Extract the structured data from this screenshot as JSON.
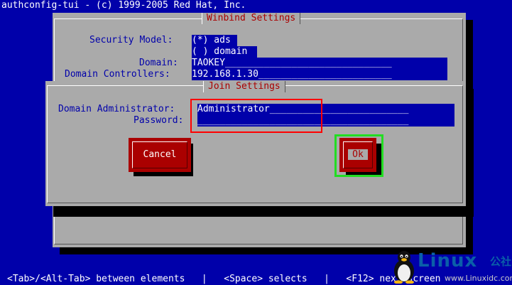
{
  "header": {
    "title": "authconfig-tui - (c) 1999-2005 Red Hat, Inc."
  },
  "winbind": {
    "title": "Winbind Settings",
    "security_model_label": "Security Model:",
    "options": [
      "(*) ads",
      "( ) domain"
    ],
    "domain_label": "Domain:",
    "domain_value": "TAOKEY______________________________",
    "dc_label": "Domain Controllers:",
    "dc_value": "192.168.1.30________________________"
  },
  "join": {
    "title": "Join Settings",
    "admin_label": "Domain Administrator:",
    "admin_value": "Administrator_________________________",
    "password_label": "Password:",
    "password_value": "______________________________________",
    "cancel_label": "Cancel",
    "ok_label": "Ok"
  },
  "status_bar": {
    "text": "<Tab>/<Alt-Tab> between elements   |   <Space> selects   |   <F12> next screen"
  },
  "watermark": {
    "brand": "Linux",
    "cn": "公社",
    "site": "www.Linuxidc.com"
  },
  "colors": {
    "background": "#0000aa",
    "dialog": "#aaaaaa",
    "button": "#aa0000",
    "highlight_red": "#ff0000",
    "highlight_green": "#22dd22"
  }
}
